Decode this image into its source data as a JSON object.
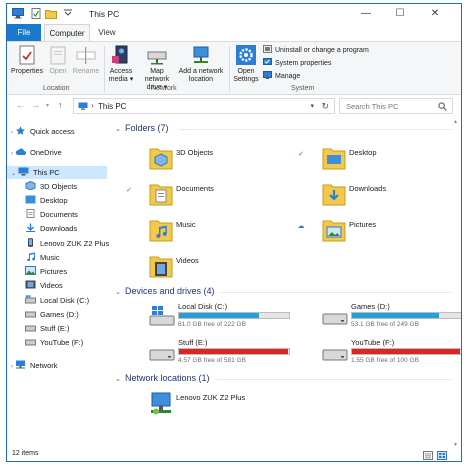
{
  "window": {
    "title": "This PC",
    "accent": "#1979ca"
  },
  "title_controls": {
    "minimize": "—",
    "maximize": "☐",
    "close": "✕"
  },
  "ribbon_tabs": {
    "file": "File",
    "computer": "Computer",
    "view": "View"
  },
  "ribbon": {
    "location": {
      "label": "Location",
      "properties": "Properties",
      "open": "Open",
      "rename": "Rename"
    },
    "network": {
      "label": "Network",
      "access_media_1": "Access",
      "access_media_2": "media ▾",
      "map_drive_1": "Map network",
      "map_drive_2": "drive ▾",
      "add_location_1": "Add a network",
      "add_location_2": "location"
    },
    "system": {
      "label": "System",
      "open_settings_1": "Open",
      "open_settings_2": "Settings",
      "uninstall": "Uninstall or change a program",
      "system_properties": "System properties",
      "manage": "Manage"
    }
  },
  "address": {
    "crumb_sep": "›",
    "path": "This PC",
    "search_placeholder": "Search This PC"
  },
  "nav": {
    "quick_access": "Quick access",
    "onedrive": "OneDrive",
    "this_pc": "This PC",
    "children": [
      "3D Objects",
      "Desktop",
      "Documents",
      "Downloads",
      "Lenovo ZUK Z2 Plus",
      "Music",
      "Pictures",
      "Videos",
      "Local Disk (C:)",
      "Games (D:)",
      "Stuff (E:)",
      "YouTube (F:)"
    ],
    "network": "Network"
  },
  "groups": {
    "folders": "Folders (7)",
    "devices": "Devices and drives (4)",
    "network": "Network locations (1)"
  },
  "folders": [
    "3D Objects",
    "Desktop",
    "Documents",
    "Downloads",
    "Music",
    "Pictures",
    "Videos"
  ],
  "drives": [
    {
      "name": "Local Disk (C:)",
      "free": "61.0 GB free of 222 GB",
      "used_fraction": 0.725,
      "color": "#26a0da"
    },
    {
      "name": "Games (D:)",
      "free": "53.1 GB free of 249 GB",
      "used_fraction": 0.787,
      "color": "#26a0da"
    },
    {
      "name": "Stuff (E:)",
      "free": "4.57 GB free of 581 GB",
      "used_fraction": 0.992,
      "color": "#da2626"
    },
    {
      "name": "YouTube (F:)",
      "free": "1.55 GB free of 100 GB",
      "used_fraction": 0.985,
      "color": "#da2626"
    }
  ],
  "network_locations": [
    "Lenovo ZUK Z2 Plus"
  ],
  "status": {
    "items": "12 items"
  }
}
